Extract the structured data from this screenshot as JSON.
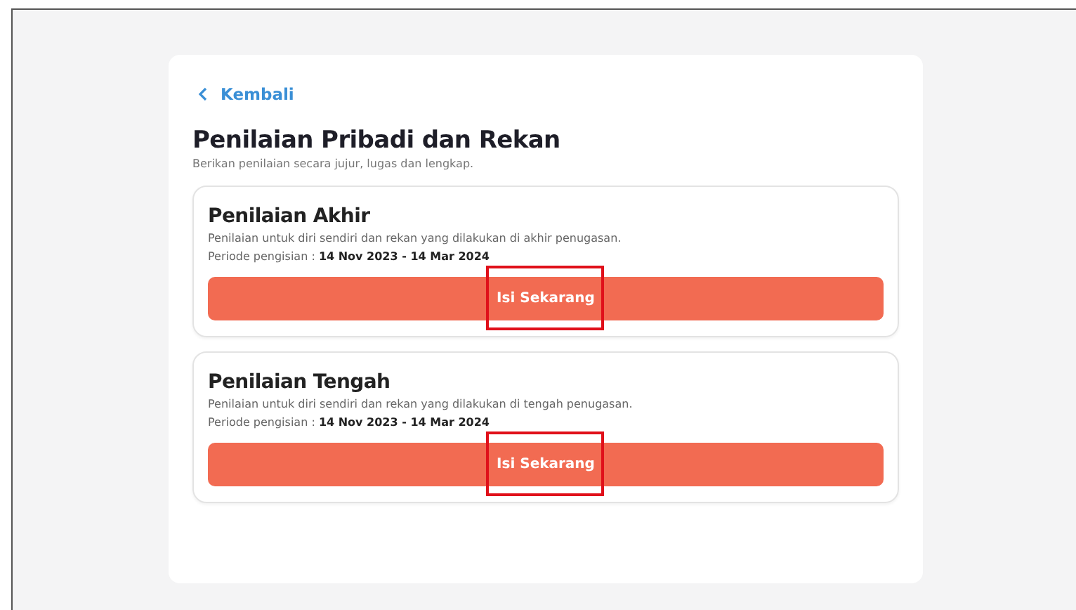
{
  "back_link": {
    "label": "Kembali"
  },
  "page": {
    "title": "Penilaian Pribadi dan Rekan",
    "subtitle": "Berikan penilaian secara jujur, lugas dan lengkap."
  },
  "assessments": [
    {
      "title": "Penilaian Akhir",
      "description": "Penilaian untuk diri sendiri dan rekan yang dilakukan di akhir penugasan.",
      "period": "Periode pengisian : **14 Nov 2023 - 14 Mar 2024**",
      "button": "Isi Sekarang",
      "highlighted": true
    },
    {
      "title": "Penilaian Tengah",
      "description": "Penilaian untuk diri sendiri dan rekan yang dilakukan di tengah penugasan.",
      "period": "Periode pengisian : **14 Nov 2023 - 14 Mar 2024**",
      "button": "Isi Sekarang",
      "highlighted": true
    }
  ]
}
